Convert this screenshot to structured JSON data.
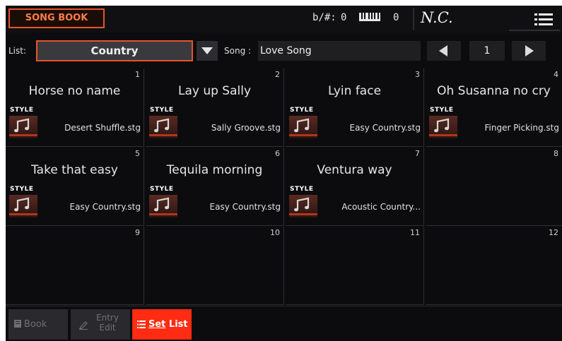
{
  "header": {
    "title": "SONG BOOK",
    "transpose_label": "b/#:",
    "transpose_value": "0",
    "octave_value": "0",
    "chord": "N.C.",
    "icons": {
      "keyboard": "keyboard-icon",
      "menu": "hamburger-menu-icon"
    }
  },
  "list_row": {
    "list_label": "List:",
    "list_value": "Country",
    "song_label": "Song :",
    "song_value": "Love Song",
    "page_number": "1"
  },
  "entries": [
    {
      "number": "1",
      "title": "Horse no name",
      "style_badge": "STYLE",
      "style_name": "Desert Shuffle.stg"
    },
    {
      "number": "2",
      "title": "Lay up Sally",
      "style_badge": "STYLE",
      "style_name": "Sally Groove.stg"
    },
    {
      "number": "3",
      "title": "Lyin face",
      "style_badge": "STYLE",
      "style_name": "Easy Country.stg"
    },
    {
      "number": "4",
      "title": "Oh Susanna no cry",
      "style_badge": "STYLE",
      "style_name": "Finger Picking.stg"
    },
    {
      "number": "5",
      "title": "Take that easy",
      "style_badge": "STYLE",
      "style_name": "Easy Country.stg"
    },
    {
      "number": "6",
      "title": "Tequila morning",
      "style_badge": "STYLE",
      "style_name": "Easy Country.stg"
    },
    {
      "number": "7",
      "title": "Ventura way",
      "style_badge": "STYLE",
      "style_name": "Acoustic Country..."
    },
    {
      "number": "8",
      "title": "",
      "style_badge": "",
      "style_name": ""
    },
    {
      "number": "9",
      "title": "",
      "style_badge": "",
      "style_name": ""
    },
    {
      "number": "10",
      "title": "",
      "style_badge": "",
      "style_name": ""
    },
    {
      "number": "11",
      "title": "",
      "style_badge": "",
      "style_name": ""
    },
    {
      "number": "12",
      "title": "",
      "style_badge": "",
      "style_name": ""
    }
  ],
  "tabs": {
    "book": "Book",
    "entry_line1": "Entry",
    "entry_line2": "Edit",
    "set_list_prefix": "Set",
    "set_list_suffix": " List"
  },
  "colors": {
    "accent": "#e8532b",
    "active_tab": "#ff2b12",
    "background": "#0c0c0e"
  }
}
